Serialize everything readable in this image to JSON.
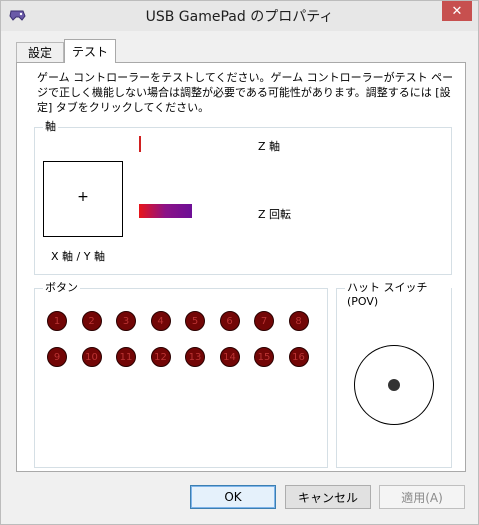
{
  "window": {
    "title": "USB GamePad のプロパティ",
    "close_symbol": "✕"
  },
  "tabs": [
    {
      "label": "設定",
      "active": false
    },
    {
      "label": "テスト",
      "active": true
    }
  ],
  "description": "ゲーム コントローラーをテストしてください。ゲーム コントローラーがテスト ページで正しく機能しない場合は調整が必要である可能性があります。調整するには [設定] タブをクリックしてください。",
  "axes": {
    "group_label": "軸",
    "xy_label": "X 軸 / Y 軸",
    "crosshair": "+",
    "z_label": "Z 軸",
    "z_rotation_label": "Z 回転",
    "z_rotation_colors": [
      "#e8141a",
      "#6d0f96"
    ]
  },
  "buttons": {
    "group_label": "ボタン",
    "labels": [
      "1",
      "2",
      "3",
      "4",
      "5",
      "6",
      "7",
      "8",
      "9",
      "10",
      "11",
      "12",
      "13",
      "14",
      "15",
      "16"
    ],
    "pressed": [],
    "color": "#720606"
  },
  "hat": {
    "group_label": "ハット スイッチ (POV)"
  },
  "dialog_buttons": {
    "ok": "OK",
    "cancel": "キャンセル",
    "apply": "適用(A)"
  }
}
